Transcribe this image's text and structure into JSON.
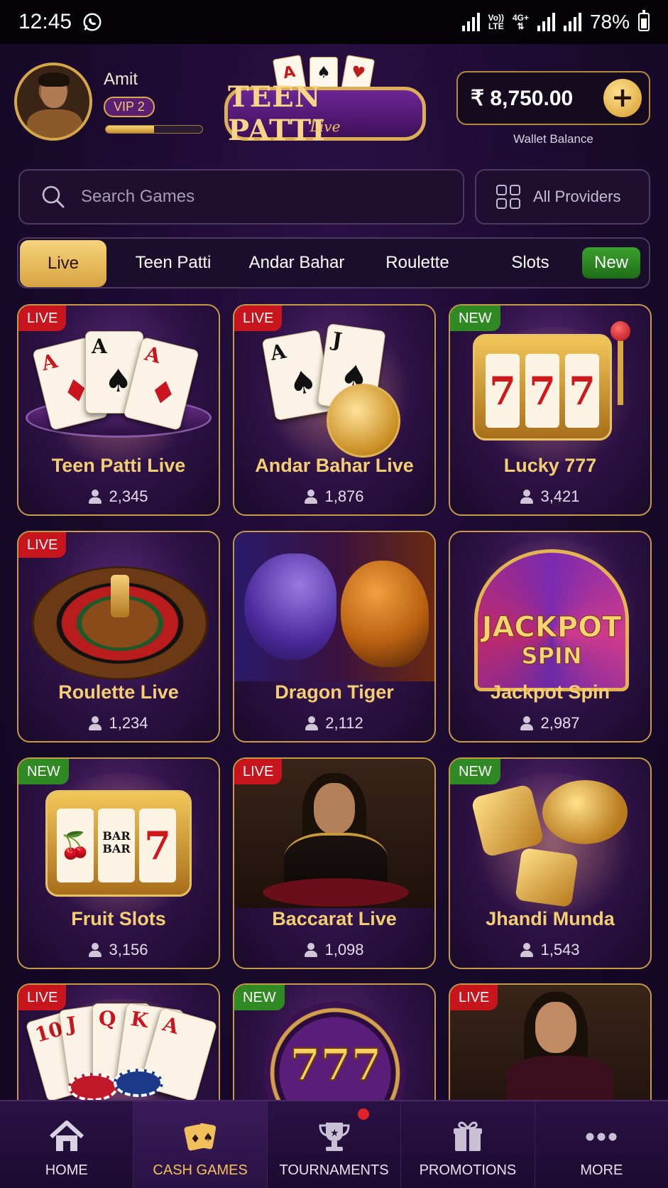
{
  "status_bar": {
    "time": "12:45",
    "net_label_1": "Vo))",
    "net_label_2": "LTE",
    "net_label_3": "4G+",
    "battery": "78%"
  },
  "user": {
    "name": "Amit",
    "vip": "VIP 2",
    "vip_progress": 0.5
  },
  "logo": {
    "title": "TEEN PATTI",
    "sub": "Live"
  },
  "wallet": {
    "amount": "₹ 8,750.00",
    "add": "+",
    "label": "Wallet Balance"
  },
  "search": {
    "placeholder": "Search Games"
  },
  "providers": {
    "label": "All Providers"
  },
  "tabs": [
    {
      "label": "Live"
    },
    {
      "label": "Teen Patti"
    },
    {
      "label": "Andar Bahar"
    },
    {
      "label": "Roulette"
    },
    {
      "label": "Slots"
    },
    {
      "label": "New"
    }
  ],
  "games": [
    {
      "title": "Teen Patti Live",
      "players": "2,345",
      "badge": "LIVE"
    },
    {
      "title": "Andar Bahar Live",
      "players": "1,876",
      "badge": "LIVE"
    },
    {
      "title": "Lucky 777",
      "players": "3,421",
      "badge": "NEW"
    },
    {
      "title": "Roulette Live",
      "players": "1,234",
      "badge": "LIVE"
    },
    {
      "title": "Dragon Tiger",
      "players": "2,112",
      "badge": ""
    },
    {
      "title": "Jackpot Spin",
      "players": "2,987",
      "badge": "",
      "art_text_1": "JACKPOT",
      "art_text_2": "SPIN"
    },
    {
      "title": "Fruit Slots",
      "players": "3,156",
      "badge": "NEW"
    },
    {
      "title": "Baccarat Live",
      "players": "1,098",
      "badge": "LIVE"
    },
    {
      "title": "Jhandi Munda",
      "players": "1,543",
      "badge": "NEW"
    },
    {
      "title": "",
      "players": "",
      "badge": "LIVE"
    },
    {
      "title": "",
      "players": "",
      "badge": "NEW",
      "art_text_1": "777"
    },
    {
      "title": "",
      "players": "",
      "badge": "LIVE"
    }
  ],
  "nav": [
    {
      "label": "HOME",
      "icon": "home-icon"
    },
    {
      "label": "CASH GAMES",
      "icon": "cards-icon"
    },
    {
      "label": "TOURNAMENTS",
      "icon": "trophy-icon"
    },
    {
      "label": "PROMOTIONS",
      "icon": "gift-icon"
    },
    {
      "label": "MORE",
      "icon": "more-dots-icon"
    }
  ],
  "colors": {
    "accent_gold": "#f4cf72",
    "live_red": "#c8141c",
    "new_green": "#2f8a24",
    "background": "#190a2c"
  }
}
